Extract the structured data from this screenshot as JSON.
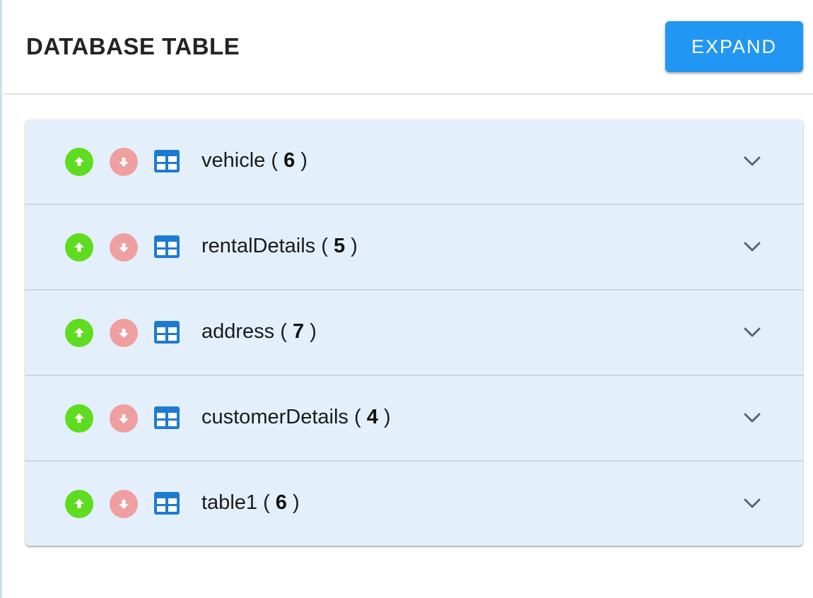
{
  "header": {
    "title": "DATABASE TABLE",
    "expand_label": "EXPAND"
  },
  "colors": {
    "accent": "#2196f3",
    "up": "#5fdc20",
    "down": "#ef9f9f",
    "panel": "#e3f0fb",
    "table_icon": "#1e7bd2"
  },
  "tables": [
    {
      "name": "vehicle",
      "count": "6"
    },
    {
      "name": "rentalDetails",
      "count": "5"
    },
    {
      "name": "address",
      "count": "7"
    },
    {
      "name": "customerDetails",
      "count": "4"
    },
    {
      "name": "table1",
      "count": "6"
    }
  ],
  "icons": {
    "up": "arrow-up-circle-icon",
    "down": "arrow-down-circle-icon",
    "table": "table-grid-icon",
    "expand": "chevron-down-icon"
  }
}
